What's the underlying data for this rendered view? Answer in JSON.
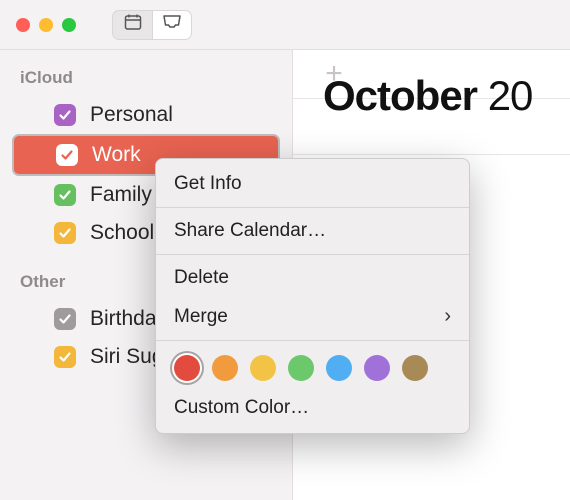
{
  "titlebar": {
    "icons": {
      "calendar": "calendar-icon",
      "inbox": "inbox-icon"
    }
  },
  "sidebar": {
    "sections": [
      {
        "name": "iCloud",
        "items": [
          {
            "label": "Personal",
            "color": "#a963c5",
            "checked": true,
            "selected": false
          },
          {
            "label": "Work",
            "color": "#e86351",
            "checked": true,
            "selected": true
          },
          {
            "label": "Family",
            "color": "#66c060",
            "checked": true,
            "selected": false
          },
          {
            "label": "School",
            "color": "#f2b73b",
            "checked": true,
            "selected": false
          }
        ]
      },
      {
        "name": "Other",
        "items": [
          {
            "label": "Birthdays",
            "color": "#9f9a9c",
            "checked": true,
            "selected": false
          },
          {
            "label": "Siri Suggestions",
            "color": "#f2b73b",
            "checked": true,
            "selected": false
          }
        ]
      }
    ]
  },
  "content": {
    "add_label": "+",
    "month_bold": "October",
    "month_rest": " 20"
  },
  "context_menu": {
    "items": {
      "get_info": "Get Info",
      "share": "Share Calendar…",
      "delete": "Delete",
      "merge": "Merge",
      "custom_color": "Custom Color…"
    },
    "colors": [
      {
        "hex": "#e24b3e",
        "selected": true
      },
      {
        "hex": "#f19a3e",
        "selected": false
      },
      {
        "hex": "#f3c345",
        "selected": false
      },
      {
        "hex": "#6bc86b",
        "selected": false
      },
      {
        "hex": "#52aef2",
        "selected": false
      },
      {
        "hex": "#a071d8",
        "selected": false
      },
      {
        "hex": "#a88a57",
        "selected": false
      }
    ]
  }
}
